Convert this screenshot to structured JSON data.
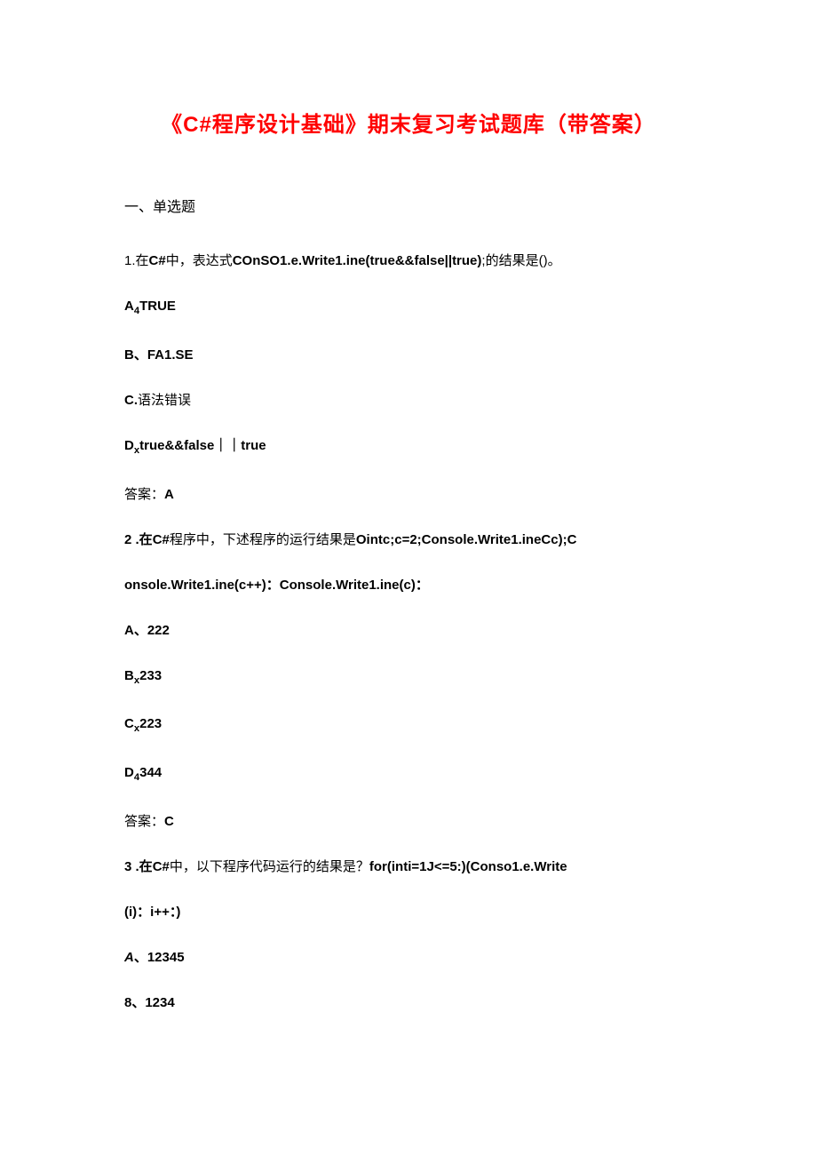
{
  "title": "《C#程序设计基础》期末复习考试题库（带答案）",
  "section": "一、单选题",
  "q1": {
    "stem_prefix": "1.在",
    "stem_bold1": "C#",
    "stem_mid1": "中，表达式",
    "stem_bold2": "COnSO1.e.Write1.ine(true&&false||true)",
    "stem_suffix": ";的结果是()。",
    "a_prefix": "A",
    "a_sub": "4",
    "a_bold": "TRUE",
    "b": "B、FA1.SE",
    "c_bold": "C.",
    "c_txt": "语法错误",
    "d_prefix": "D",
    "d_sub": "x",
    "d_bold": "true&&false｜｜true",
    "ans_label": "答案：",
    "ans_val": "A"
  },
  "q2": {
    "stem_prefix": "2   .在",
    "stem_bold1": "C#",
    "stem_mid1": "程序中，下述程序的运行结果是",
    "stem_bold2": "Ointc;c=2;Console.Write1.ineCc);C",
    "line2": "onsole.Write1.ine(c++)：Console.Write1.ine(c)：",
    "a": "A、222",
    "b_prefix": "B",
    "b_sub": "x",
    "b_bold": "233",
    "c_prefix": "C",
    "c_sub": "x",
    "c_bold": "223",
    "d_prefix": "D",
    "d_sub": "4",
    "d_bold": "344",
    "ans_label": "答案：",
    "ans_val": "C"
  },
  "q3": {
    "stem_prefix": "3   .在",
    "stem_bold1": "C#",
    "stem_mid1": "中，以下程序代码运行的结果是？",
    "stem_bold2": "for(inti=1J<=5:)(Conso1.e.Write",
    "line2": "(i)：i++：)",
    "a_italic": "A",
    "a_bold": "、12345",
    "b": "8、1234"
  }
}
